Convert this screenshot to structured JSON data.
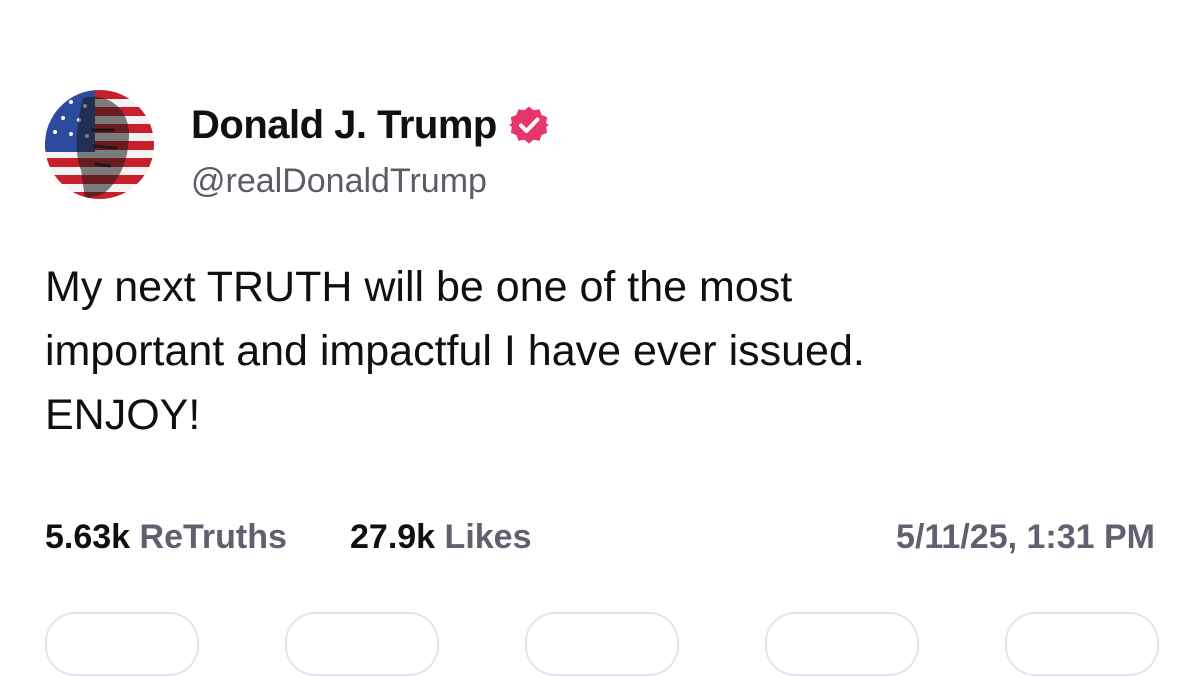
{
  "author": {
    "display_name": "Donald J. Trump",
    "handle": "@realDonaldTrump",
    "verified": true,
    "badge_color": "#e8356d"
  },
  "post": {
    "lines": [
      "My next TRUTH will be one of the most",
      "important and impactful I have ever issued.",
      "ENJOY!"
    ]
  },
  "stats": {
    "retruths_count": "5.63k",
    "retruths_label": "ReTruths",
    "likes_count": "27.9k",
    "likes_label": "Likes",
    "timestamp": "5/11/25, 1:31 PM"
  },
  "actions": [
    {
      "icon": "reply-icon"
    },
    {
      "icon": "retruth-icon"
    },
    {
      "icon": "like-icon"
    },
    {
      "icon": "bookmark-icon"
    },
    {
      "icon": "share-icon"
    }
  ]
}
